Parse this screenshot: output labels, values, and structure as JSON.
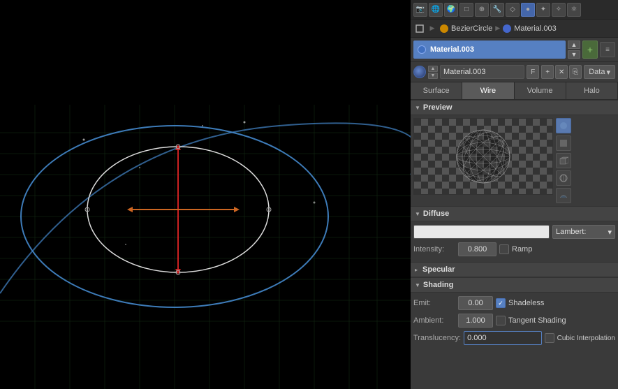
{
  "viewport": {
    "background": "#000000"
  },
  "breadcrumb": {
    "item1": "BezierCircle",
    "arrow1": "▶",
    "item2": "Material.003",
    "arrow2": "▶"
  },
  "material": {
    "name": "Material.003",
    "list_name": "Material.003",
    "field_name": "Material.003",
    "letter": "F"
  },
  "toolbar": {
    "data_label": "Data",
    "plus_icon": "+"
  },
  "tabs": [
    {
      "id": "surface",
      "label": "Surface"
    },
    {
      "id": "wire",
      "label": "Wire",
      "active": true
    },
    {
      "id": "volume",
      "label": "Volume"
    },
    {
      "id": "halo",
      "label": "Halo"
    }
  ],
  "preview": {
    "section_label": "Preview"
  },
  "diffuse": {
    "section_label": "Diffuse",
    "shader_label": "Lambert:",
    "intensity_label": "Intensity:",
    "intensity_value": "0.800",
    "ramp_label": "Ramp"
  },
  "specular": {
    "section_label": "Specular"
  },
  "shading": {
    "section_label": "Shading",
    "emit_label": "Emit:",
    "emit_value": "0.00",
    "shadeless_label": "Shadeless",
    "ambient_label": "Ambient:",
    "ambient_value": "1.000",
    "tangent_label": "Tangent Shading",
    "translucency_label": "Translucency:",
    "translucency_value": "0.000",
    "cubic_label": "Cubic Interpolation"
  },
  "icons": {
    "chevron_down": "▼",
    "chevron_right": "▶",
    "triangle_down": "▾",
    "triangle_right": "▸",
    "plus": "+",
    "minus": "−",
    "x": "✕",
    "check": "✓",
    "sphere": "●",
    "gear": "⚙",
    "link": "🔗"
  }
}
